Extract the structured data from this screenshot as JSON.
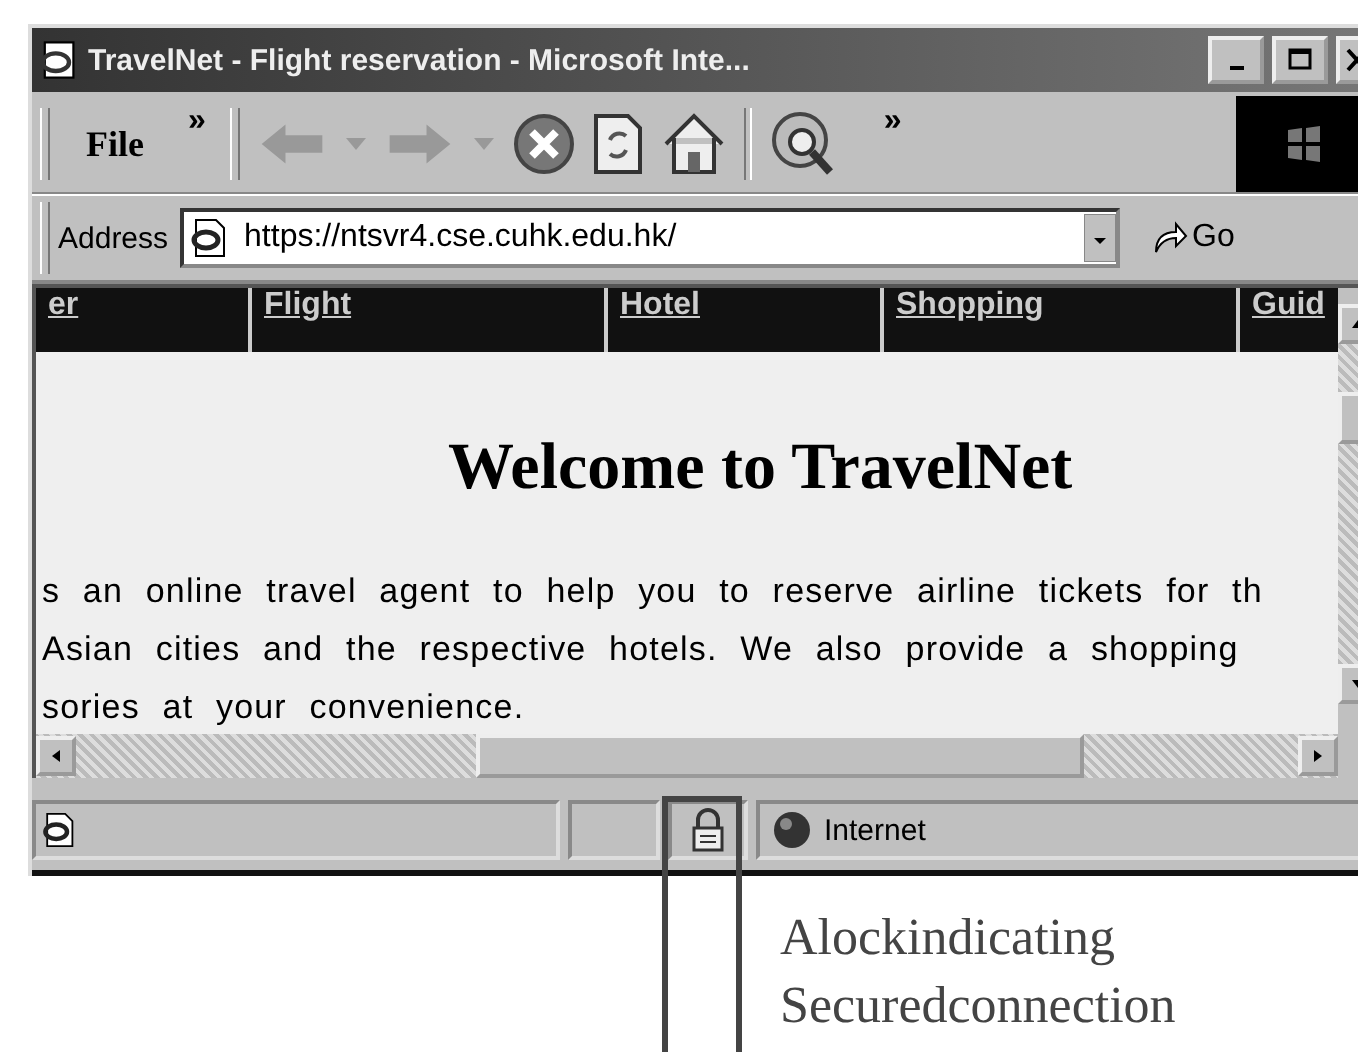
{
  "window": {
    "title": "TravelNet - Flight reservation - Microsoft Inte..."
  },
  "menu": {
    "items": [
      "File"
    ],
    "more": "»"
  },
  "toolbar": {
    "more": "»"
  },
  "address_bar": {
    "label": "Address",
    "value": "https://ntsvr4.cse.cuhk.edu.hk/",
    "go": "Go"
  },
  "page": {
    "nav": [
      "er",
      "Flight",
      "Hotel",
      "Shopping",
      "Guid"
    ],
    "heading": "Welcome to TravelNet",
    "body_lines": [
      "s an online travel agent to help you to reserve airline tickets for th",
      "Asian cities and the respective hotels. We also provide a shopping",
      "sories at your convenience."
    ]
  },
  "status_bar": {
    "zone": "Internet",
    "secure": true
  },
  "annotation": {
    "lines": [
      "Alockindicating",
      "Securedconnection"
    ]
  }
}
